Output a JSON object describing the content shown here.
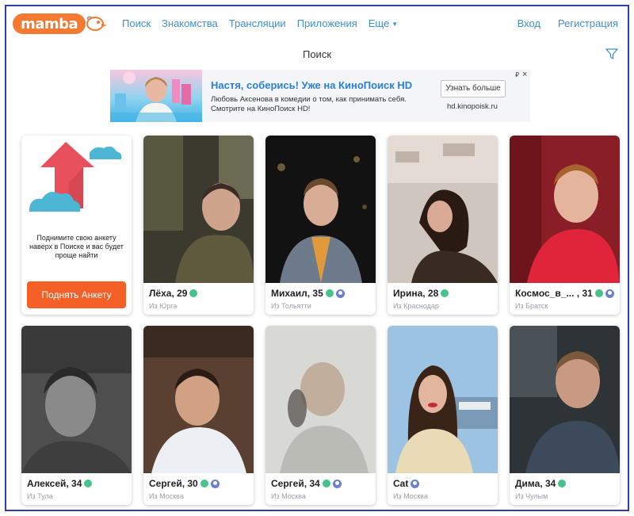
{
  "header": {
    "logo_text": "mamba",
    "nav": [
      "Поиск",
      "Знакомства",
      "Трансляции",
      "Приложения",
      "Еще"
    ],
    "auth": {
      "login": "Вход",
      "register": "Регистрация"
    }
  },
  "page": {
    "title": "Поиск"
  },
  "ad": {
    "headline": "Настя, соберись! Уже на КиноПоиск HD",
    "body": "Любовь Аксенова в комедии о том, как принимать себя. Смотрите на КиноПоиск HD!",
    "button": "Узнать больше",
    "domain": "hd.kinopoisk.ru",
    "currency": "₽",
    "close": "×"
  },
  "promo": {
    "text": "Поднимите свою анкету наверх в Поиске и вас будет проще найти",
    "button": "Поднять Анкету"
  },
  "profiles": [
    {
      "name": "Лёха, 29",
      "city": "Из Юрга",
      "online": true,
      "verified": false
    },
    {
      "name": "Михаил, 35",
      "city": "Из Тольятти",
      "online": true,
      "verified": true
    },
    {
      "name": "Ирина, 28",
      "city": "Из Краснодар",
      "online": true,
      "verified": false
    },
    {
      "name": "Космос_в_... , 31",
      "city": "Из Братск",
      "online": true,
      "verified": true
    },
    {
      "name": "Алексей, 34",
      "city": "Из Тула",
      "online": true,
      "verified": false
    },
    {
      "name": "Сергей, 30",
      "city": "Из Москва",
      "online": true,
      "verified": true
    },
    {
      "name": "Сергей, 34",
      "city": "Из Москва",
      "online": true,
      "verified": true
    },
    {
      "name": "Cat",
      "city": "Из Москва",
      "online": false,
      "verified": true
    },
    {
      "name": "Дима, 34",
      "city": "Из Чулым",
      "online": true,
      "verified": false
    }
  ],
  "colors": {
    "brand": "#f47a32",
    "link": "#3f8fd2",
    "promo_button": "#f35f24",
    "online": "#45c48a",
    "verified": "#6b7fcf"
  }
}
